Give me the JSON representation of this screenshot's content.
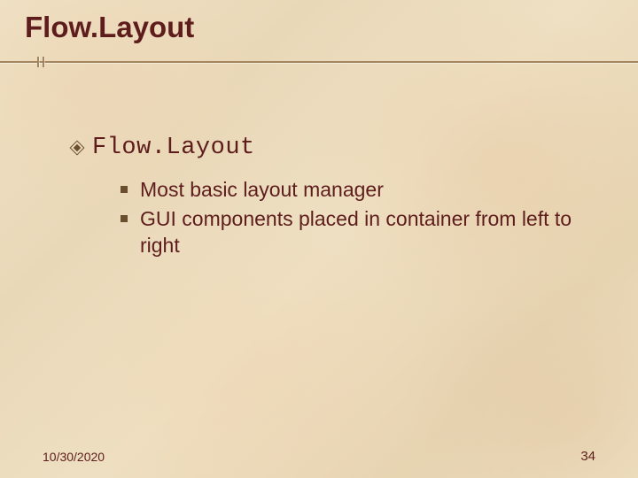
{
  "title": "Flow.Layout",
  "section": {
    "heading": "Flow.Layout",
    "items": [
      "Most basic layout manager",
      "GUI components placed in container from left to right"
    ]
  },
  "footer": {
    "date": "10/30/2020",
    "page": "34"
  }
}
